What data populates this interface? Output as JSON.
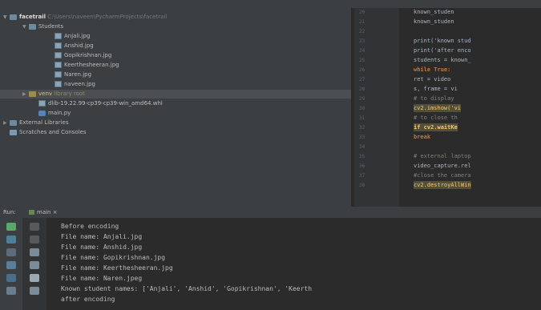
{
  "project": {
    "root_label": "facetrail",
    "root_path": "C:\\Users\\naveen\\PycharmProjects\\facetrail",
    "students_folder": "Students",
    "files": [
      "Anjali.jpg",
      "Anshid.jpg",
      "Gopikrishnan.jpg",
      "Keerthesheeran.jpg",
      "Naren.jpg",
      "naveen.jpg"
    ],
    "venv_label": "venv",
    "venv_sub": "library root",
    "dlib_label": "dlib-19.22.99-cp39-cp39-win_amd64.whl",
    "main_file": "main.py",
    "external_libraries": "External Libraries",
    "scratches": "Scratches and Consoles"
  },
  "editor": {
    "line_numbers": [
      "20",
      "21",
      "22",
      "23",
      "24",
      "25",
      "26",
      "27",
      "28",
      "29",
      "30",
      "31",
      "32",
      "33",
      "34",
      "35",
      "36",
      "37",
      "38"
    ],
    "lines": [
      "        known_studen",
      "        known_studen",
      "",
      "print('known stud",
      "print('after enco",
      "students = known_",
      "while True:",
      "    ret = video",
      "    s, frame = vi",
      "    # to display",
      "    cv2.imshow('vi",
      "    # to close th",
      "    if cv2.waitKe",
      "        break",
      "",
      "# external laptop",
      "video_capture.rel",
      "#close the camera",
      "cv2.destroyAllWin"
    ]
  },
  "run": {
    "label": "Run:",
    "tab": "main",
    "output": [
      "Before encoding",
      "File name: Anjali.jpg",
      "File name: Anshid.jpg",
      "File name: Gopikrishnan.jpg",
      "File name: Keerthesheeran.jpg",
      "File name: Naren.jpeg",
      "Known student names: ['Anjali', 'Anshid', 'Gopikrishnan', 'Keerth",
      "after encoding"
    ]
  },
  "colors": {
    "panel": "#3c3f41",
    "editor_bg": "#2b2b2b",
    "keyword": "#cc7832",
    "highlight": "#52503a"
  }
}
